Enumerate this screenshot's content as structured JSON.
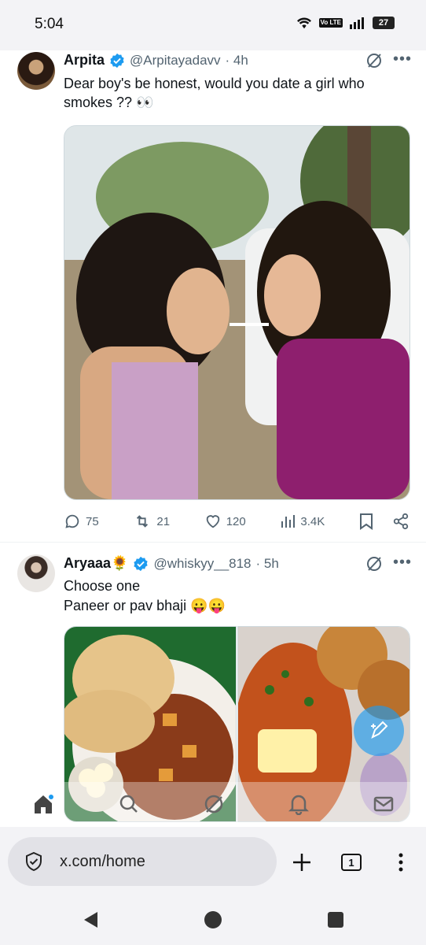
{
  "status_bar": {
    "time": "5:04",
    "network": "Vo LTE",
    "battery": "27"
  },
  "tweets": [
    {
      "name": "Arpita",
      "handle": "@Arpitayadavv",
      "time": "· 4h",
      "text": "Dear boy's be honest, would you date a girl who smokes ?? 👀",
      "replies": "75",
      "retweets": "21",
      "likes": "120",
      "views": "3.4K"
    },
    {
      "name": "Aryaaa🌻",
      "handle": "@whiskyy__818",
      "time": "· 5h",
      "text_line1": "Choose one",
      "text_line2": "Paneer or pav bhaji 😛😛"
    }
  ],
  "browser": {
    "url": "x.com/home",
    "tab_count": "1"
  },
  "colors": {
    "accent": "#1d9bf0",
    "text": "#0f1419",
    "muted": "#536471"
  }
}
